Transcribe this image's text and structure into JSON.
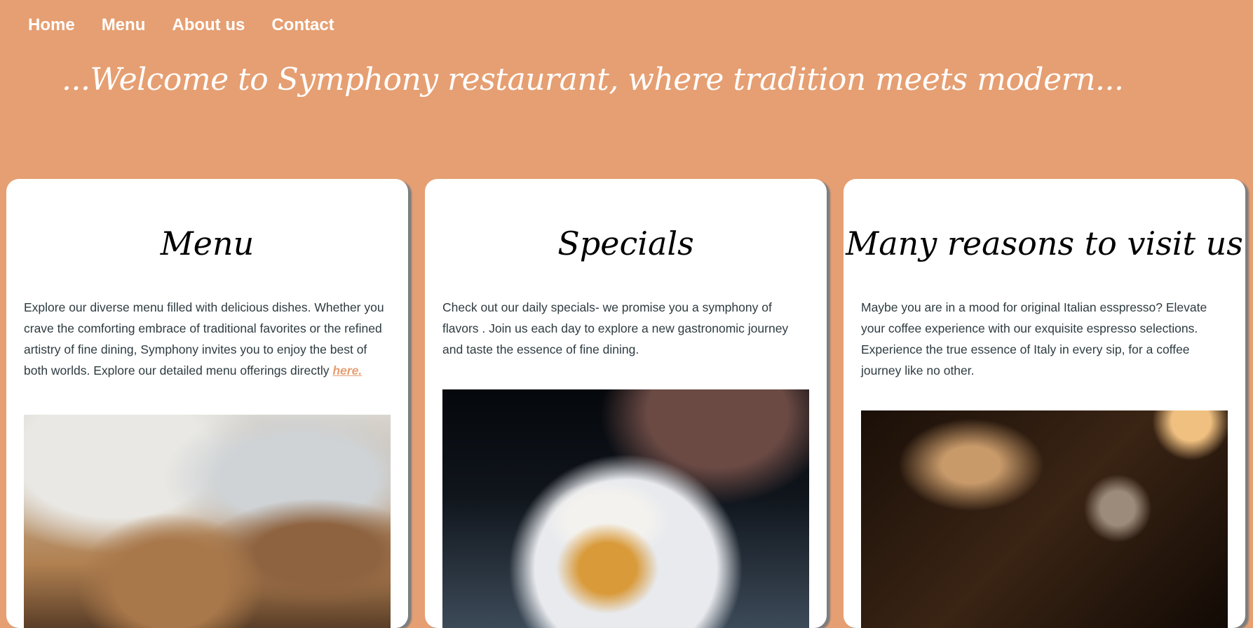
{
  "nav": {
    "items": [
      {
        "label": "Home"
      },
      {
        "label": "Menu"
      },
      {
        "label": "About us"
      },
      {
        "label": "Contact"
      }
    ]
  },
  "hero": {
    "welcome": "...Welcome to Symphony restaurant, where tradition meets modern..."
  },
  "colors": {
    "background": "#e69f72",
    "card": "#ffffff",
    "text": "#2e3b40",
    "link": "#e69f72"
  },
  "cards": [
    {
      "title": "Menu",
      "text": "Explore our diverse menu filled with delicious dishes. Whether you crave the comforting embrace of traditional favorites or the refined artistry of fine dining, Symphony invites you to enjoy the best of both worlds. Explore our detailed menu offerings directly ",
      "link": "here."
    },
    {
      "title": "Specials",
      "text": "Check out our daily specials- we promise you a symphony of flavors . Join us each day to explore a new gastronomic journey and taste the essence of fine dining."
    },
    {
      "title": "Many reasons to visit us",
      "text": "Maybe you are in a mood for original Italian esspresso? Elevate your coffee experience with our exquisite espresso selections. Experience the true essence of Italy in every sip, for a coffee journey like no other."
    }
  ]
}
